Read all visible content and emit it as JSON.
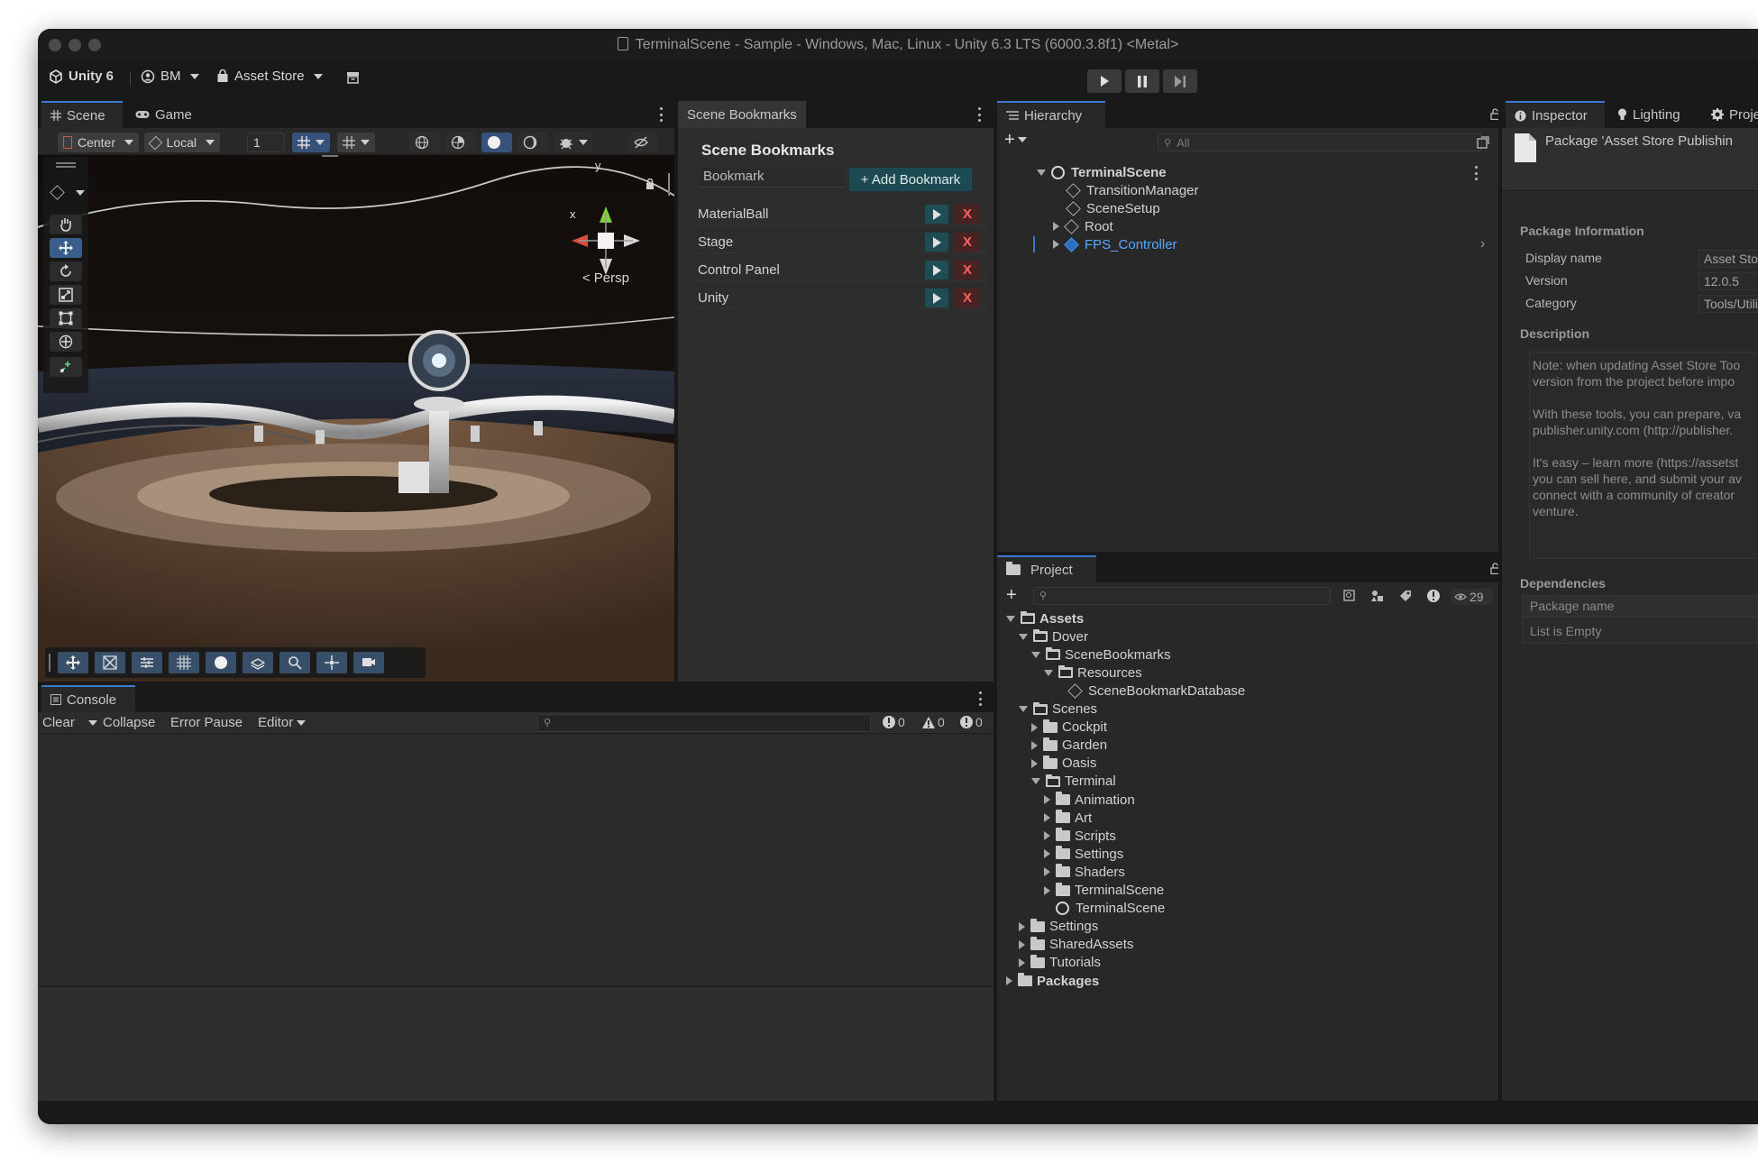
{
  "window": {
    "title": "TerminalScene - Sample - Windows, Mac, Linux - Unity 6.3 LTS (6000.3.8f1) <Metal>"
  },
  "toolbar": {
    "unity_label": "Unity 6",
    "account_label": "BM",
    "asset_store_label": "Asset Store"
  },
  "scene_panel": {
    "tabs": [
      "Scene",
      "Game"
    ],
    "pivot_label": "Center",
    "space_label": "Local",
    "grid_value": "1",
    "persp_label": "Persp",
    "gizmo_x": "x",
    "gizmo_y": "y"
  },
  "bookmarks": {
    "tab_label": "Scene Bookmarks",
    "heading": "Scene Bookmarks",
    "input_placeholder": "Bookmark",
    "add_label": "+ Add Bookmark",
    "items": [
      {
        "label": "MaterialBall"
      },
      {
        "label": "Stage"
      },
      {
        "label": "Control Panel"
      },
      {
        "label": "Unity"
      }
    ],
    "remove_label": "X"
  },
  "hierarchy": {
    "tab_label": "Hierarchy",
    "search_placeholder": "All",
    "scene_name": "TerminalScene",
    "items": [
      {
        "label": "TransitionManager"
      },
      {
        "label": "SceneSetup"
      },
      {
        "label": "Root"
      },
      {
        "label": "FPS_Controller"
      }
    ]
  },
  "inspector": {
    "tabs": [
      "Inspector",
      "Lighting",
      "Proje"
    ],
    "header": "Package 'Asset Store Publishin",
    "section_info": "Package Information",
    "fields": [
      {
        "label": "Display name",
        "value": "Asset Stor"
      },
      {
        "label": "Version",
        "value": "12.0.5"
      },
      {
        "label": "Category",
        "value": "Tools/Utili"
      }
    ],
    "section_desc": "Description",
    "desc_lines": [
      "Note: when updating Asset Store Too",
      "version from the project before impo",
      "With these tools, you can prepare, va",
      "publisher.unity.com (http://publisher.",
      "It's easy – learn more (https://assetst",
      "you can sell here, and submit your av",
      "connect with a community of creator",
      "venture."
    ],
    "section_deps": "Dependencies",
    "deps_header": "Package name",
    "deps_empty": "List is Empty"
  },
  "console": {
    "tab_label": "Console",
    "clear_label": "Clear",
    "collapse_label": "Collapse",
    "error_pause_label": "Error Pause",
    "editor_label": "Editor",
    "count_info": "0",
    "count_warn": "0",
    "count_error": "0"
  },
  "project": {
    "tab_label": "Project",
    "hidden_count": "29",
    "tree": [
      {
        "label": "Assets",
        "depth": 0,
        "kind": "folder-open",
        "arrow": "down",
        "bold": true
      },
      {
        "label": "Dover",
        "depth": 1,
        "kind": "folder-open",
        "arrow": "down"
      },
      {
        "label": "SceneBookmarks",
        "depth": 2,
        "kind": "folder-open",
        "arrow": "down"
      },
      {
        "label": "Resources",
        "depth": 3,
        "kind": "folder-open",
        "arrow": "down"
      },
      {
        "label": "SceneBookmarkDatabase",
        "depth": 4,
        "kind": "asset",
        "arrow": "none"
      },
      {
        "label": "Scenes",
        "depth": 1,
        "kind": "folder-open",
        "arrow": "down"
      },
      {
        "label": "Cockpit",
        "depth": 2,
        "kind": "folder",
        "arrow": "right"
      },
      {
        "label": "Garden",
        "depth": 2,
        "kind": "folder",
        "arrow": "right"
      },
      {
        "label": "Oasis",
        "depth": 2,
        "kind": "folder",
        "arrow": "right"
      },
      {
        "label": "Terminal",
        "depth": 2,
        "kind": "folder-open",
        "arrow": "down"
      },
      {
        "label": "Animation",
        "depth": 3,
        "kind": "folder",
        "arrow": "right"
      },
      {
        "label": "Art",
        "depth": 3,
        "kind": "folder",
        "arrow": "right"
      },
      {
        "label": "Scripts",
        "depth": 3,
        "kind": "folder",
        "arrow": "right"
      },
      {
        "label": "Settings",
        "depth": 3,
        "kind": "folder",
        "arrow": "right"
      },
      {
        "label": "Shaders",
        "depth": 3,
        "kind": "folder",
        "arrow": "right"
      },
      {
        "label": "TerminalScene",
        "depth": 3,
        "kind": "folder",
        "arrow": "right"
      },
      {
        "label": "TerminalScene",
        "depth": 3,
        "kind": "scene",
        "arrow": "none"
      },
      {
        "label": "Settings",
        "depth": 1,
        "kind": "folder",
        "arrow": "right"
      },
      {
        "label": "SharedAssets",
        "depth": 1,
        "kind": "folder",
        "arrow": "right"
      },
      {
        "label": "Tutorials",
        "depth": 1,
        "kind": "folder",
        "arrow": "right"
      },
      {
        "label": "Packages",
        "depth": 0,
        "kind": "folder",
        "arrow": "right",
        "bold": true
      }
    ]
  }
}
